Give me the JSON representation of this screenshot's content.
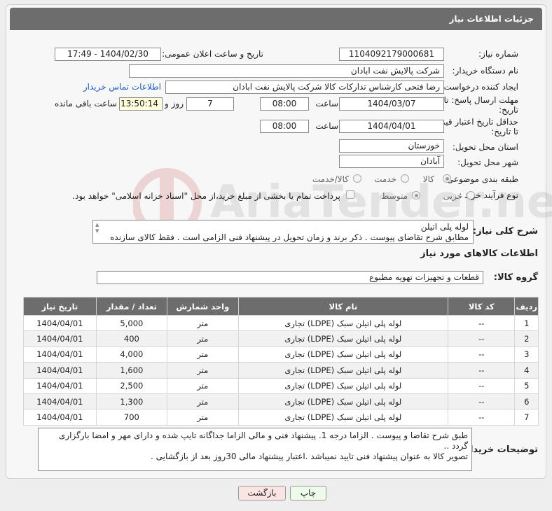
{
  "header": {
    "title": "جزئیات اطلاعات نیاز"
  },
  "form": {
    "need_number": {
      "label": "شماره نیاز:",
      "value": "1104092179000681"
    },
    "announce": {
      "label": "تاریخ و ساعت اعلان عمومی:",
      "value": "1404/02/30 - 17:49"
    },
    "buyer_org": {
      "label": "نام دستگاه خریدار:",
      "value": "شرکت پالایش نفت ابادان"
    },
    "creator": {
      "label": "ایجاد کننده درخواست:",
      "value": "رضا فتحی کارشناس تدارکات کالا  شرکت پالایش نفت ابادان",
      "contact_link": "اطلاعات تماس خریدار"
    },
    "reply_deadline": {
      "label_line1": "مهلت ارسال پاسخ: تا",
      "label_line2": "تاریخ:",
      "date": "1404/03/07",
      "time_label": "ساعت",
      "time": "08:00",
      "days": "7",
      "days_label": "روز و",
      "remaining": "13:50:14",
      "remaining_label": "ساعت باقی مانده"
    },
    "price_validity": {
      "label_line1": "حداقل تاریخ اعتبار قیمت:",
      "label_line2": "تا تاریخ:",
      "date": "1404/04/01",
      "time_label": "ساعت",
      "time": "08:00"
    },
    "province": {
      "label": "استان محل تحویل:",
      "value": "خوزستان"
    },
    "city": {
      "label": "شهر محل تحویل:",
      "value": "آبادان"
    },
    "category": {
      "label": "طبقه بندی موضوعی:",
      "options": [
        "کالا",
        "خدمت",
        "کالا/خدمت"
      ],
      "selected": "کالا"
    },
    "purchase_type": {
      "label": "نوع فرآیند خرید :",
      "options": [
        "جزیی",
        "متوسط"
      ],
      "selected": "متوسط",
      "payment_note": "پرداخت تمام یا بخشی از مبلغ خرید،از محل \"اسناد خزانه اسلامی\" خواهد بود."
    },
    "general_desc": {
      "label": "شرح کلی نیاز:",
      "line1": "لوله پلی اتیلن",
      "line2": "مطابق شرح تقاضای پیوست . ذکر برند و زمان تحویل در پیشنهاد فنی الزامی است . فقط کالای سازنده"
    }
  },
  "goods": {
    "section_title": "اطلاعات کالاهای مورد نیاز",
    "group_label": "گروه کالا:",
    "group_value": "قطعات و تجهیزات تهویه مطبوع",
    "columns": [
      "ردیف",
      "کد کالا",
      "نام کالا",
      "واحد شمارش",
      "تعداد / مقدار",
      "تاریخ نیاز"
    ],
    "rows": [
      {
        "idx": "1",
        "code": "--",
        "name": "لوله پلی اتیلن سبک (LDPE) تجاری",
        "unit": "متر",
        "qty": "5,000",
        "date": "1404/04/01"
      },
      {
        "idx": "2",
        "code": "--",
        "name": "لوله پلی اتیلن سبک (LDPE) تجاری",
        "unit": "متر",
        "qty": "400",
        "date": "1404/04/01"
      },
      {
        "idx": "3",
        "code": "--",
        "name": "لوله پلی اتیلن سبک (LDPE) تجاری",
        "unit": "متر",
        "qty": "4,000",
        "date": "1404/04/01"
      },
      {
        "idx": "4",
        "code": "--",
        "name": "لوله پلی اتیلن سبک (LDPE) تجاری",
        "unit": "متر",
        "qty": "1,600",
        "date": "1404/04/01"
      },
      {
        "idx": "5",
        "code": "--",
        "name": "لوله پلی اتیلن سبک (LDPE) تجاری",
        "unit": "متر",
        "qty": "2,500",
        "date": "1404/04/01"
      },
      {
        "idx": "6",
        "code": "--",
        "name": "لوله پلی اتیلن سبک (LDPE) تجاری",
        "unit": "متر",
        "qty": "1,300",
        "date": "1404/04/01"
      },
      {
        "idx": "7",
        "code": "--",
        "name": "لوله پلی اتیلن سبک (LDPE) تجاری",
        "unit": "متر",
        "qty": "700",
        "date": "1404/04/01"
      }
    ]
  },
  "buyer_notes": {
    "label": "توضیحات خریدار:",
    "line1": "طبق شرح تقاضا و پیوست . الزاما درجه 1. پیشنهاد فنی و مالی الزاما جداگانه تایپ شده و دارای مهر و امضا بارگزاری گردد ..",
    "line2": "تصویر کالا به عنوان پیشنهاد فنی تایید نمیباشد .اعتبار پیشنهاد مالی 30روز بعد از بازگشایی ."
  },
  "buttons": {
    "print": "چاپ",
    "back": "بازگشت"
  },
  "watermark": {
    "text": "AriaTender.neT",
    "icon": "aria-logo-icon"
  }
}
